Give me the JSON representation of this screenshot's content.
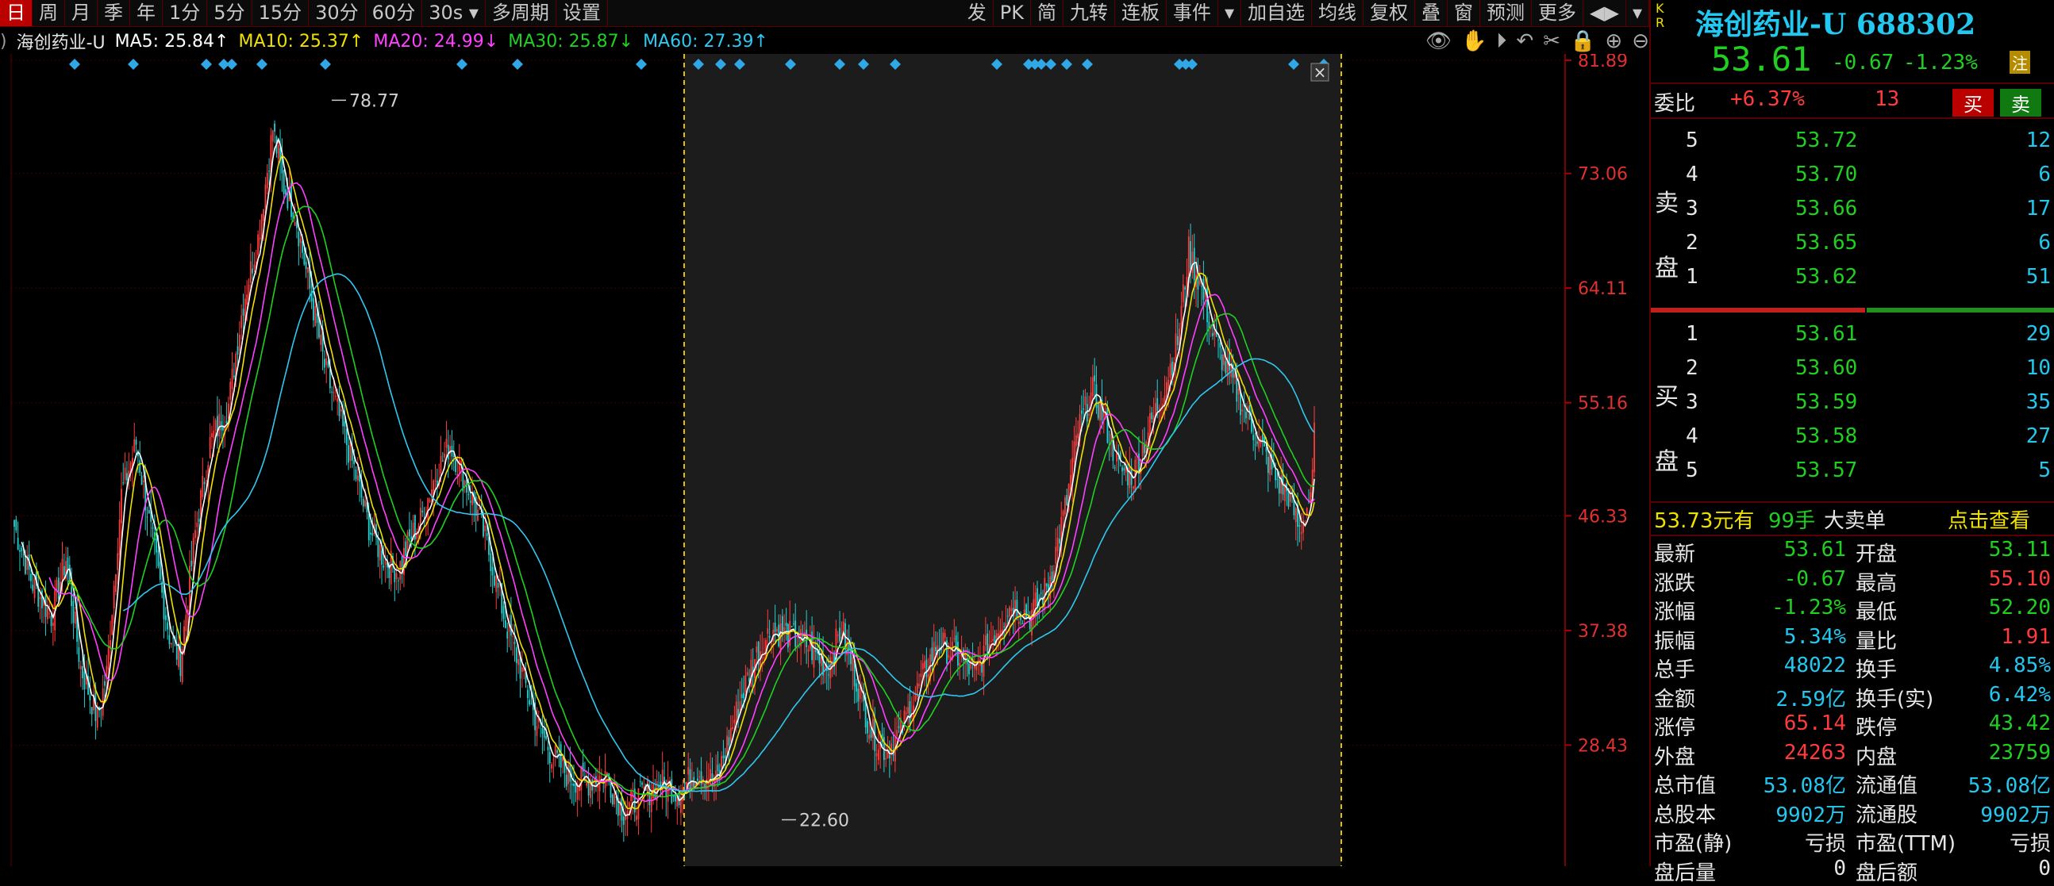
{
  "toolbar": {
    "left": [
      "日",
      "周",
      "月",
      "季",
      "年",
      "1分",
      "5分",
      "15分",
      "30分",
      "60分",
      "30s ▾",
      "多周期",
      "设置"
    ],
    "right": [
      "发",
      "PK",
      "简",
      "九转",
      "连板",
      "事件",
      "▾",
      "加自选",
      "均线",
      "复权",
      "叠",
      "窗",
      "预测",
      "更多",
      "◀▶",
      "▾"
    ]
  },
  "ma_legend": {
    "name": "海创药业-U",
    "ma5": "MA5: 25.84↑",
    "ma10": "MA10: 25.37↑",
    "ma20": "MA20: 24.99↓",
    "ma30": "MA30: 25.87↓",
    "ma60": "MA60: 27.39↑"
  },
  "colors": {
    "ma5": "#ffffff",
    "ma10": "#f0e000",
    "ma20": "#ff40ff",
    "ma30": "#20d020",
    "ma60": "#30c8f0",
    "up": "#ff3b3b",
    "down": "#22d0d0",
    "highlight": "#1c1c1c"
  },
  "chart_data": {
    "type": "candlestick",
    "y_ticks": [
      81.89,
      73.06,
      64.11,
      55.16,
      46.33,
      37.38,
      28.43
    ],
    "annotations": {
      "high": "78.77",
      "low": "22.60"
    },
    "highlight_range": "selected interval (dashed yellow)",
    "ylim": [
      19.6,
      81.89
    ]
  },
  "panel": {
    "stock_name": "海创药业-U 688302",
    "price": "53.61",
    "change": "-0.67",
    "change_pct": "-1.23%",
    "tag": "注",
    "kr": "K\nR",
    "weibi_label": "委比",
    "weibi_value": "+6.37%",
    "weibi_count": "13",
    "buy_btn": "买",
    "sell_btn": "卖",
    "sell_label": [
      "卖",
      "盘"
    ],
    "buy_label": [
      "买",
      "盘"
    ],
    "sells": [
      [
        "5",
        "53.72",
        "12"
      ],
      [
        "4",
        "53.70",
        "6"
      ],
      [
        "3",
        "53.66",
        "17"
      ],
      [
        "2",
        "53.65",
        "6"
      ],
      [
        "1",
        "53.62",
        "51"
      ]
    ],
    "buys": [
      [
        "1",
        "53.61",
        "29"
      ],
      [
        "2",
        "53.60",
        "10"
      ],
      [
        "3",
        "53.59",
        "35"
      ],
      [
        "4",
        "53.58",
        "27"
      ],
      [
        "5",
        "53.57",
        "5"
      ]
    ],
    "bigorder": {
      "price": "53.73元有",
      "qty": "99手",
      "text": "大卖单",
      "link": "点击查看"
    },
    "stats": [
      [
        "最新",
        "53.61",
        "开盘",
        "53.11"
      ],
      [
        "涨跌",
        "-0.67",
        "最高",
        "55.10"
      ],
      [
        "涨幅",
        "-1.23%",
        "最低",
        "52.20"
      ],
      [
        "振幅",
        "5.34%",
        "量比",
        "1.91"
      ],
      [
        "总手",
        "48022",
        "换手",
        "4.85%"
      ],
      [
        "金额",
        "2.59亿",
        "换手(实)",
        "6.42%"
      ],
      [
        "涨停",
        "65.14",
        "跌停",
        "43.42"
      ],
      [
        "外盘",
        "24263",
        "内盘",
        "23759"
      ],
      [
        "总市值",
        "53.08亿",
        "流通值",
        "53.08亿"
      ],
      [
        "总股本",
        "9902万",
        "流通股",
        "9902万"
      ],
      [
        "市盈(静)",
        "亏损",
        "市盈(TTM)",
        "亏损"
      ],
      [
        "盘后量",
        "0",
        "盘后额",
        "0"
      ]
    ]
  }
}
